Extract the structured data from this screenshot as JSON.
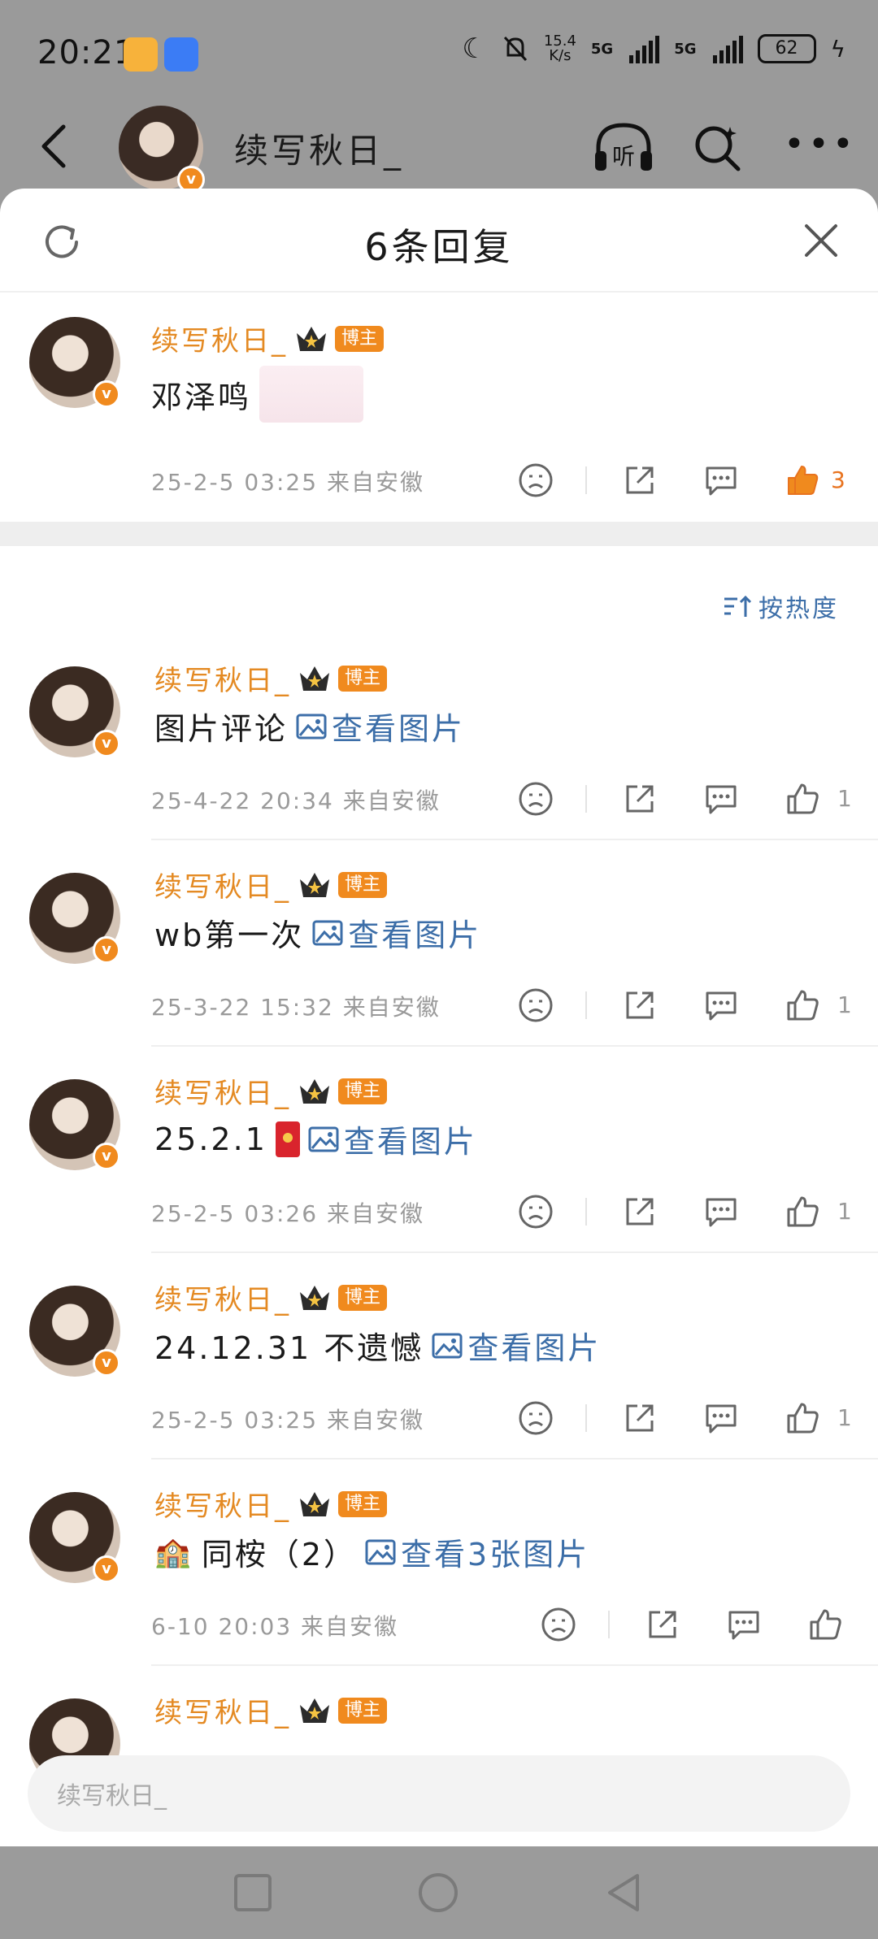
{
  "status_bar": {
    "time": "20:21",
    "net_speed_value": "15.4",
    "net_speed_unit": "K/s",
    "signal_1": "5G",
    "signal_2": "5G",
    "battery": "62"
  },
  "header": {
    "title": "续写秋日_"
  },
  "sheet": {
    "title": "6条回复"
  },
  "top_comment": {
    "username": "续写秋日_",
    "badge": "博主",
    "text": "邓泽鸣",
    "meta": "25-2-5 03:25 来自安徽",
    "likes": "3"
  },
  "sort_label": "按热度",
  "replies": [
    {
      "username": "续写秋日_",
      "badge": "博主",
      "text": "图片评论",
      "link": "查看图片",
      "meta": "25-4-22 20:34 来自安徽",
      "likes": "1"
    },
    {
      "username": "续写秋日_",
      "badge": "博主",
      "text": "wb第一次",
      "link": "查看图片",
      "meta": "25-3-22 15:32 来自安徽",
      "likes": "1"
    },
    {
      "username": "续写秋日_",
      "badge": "博主",
      "text": "25.2.1",
      "link": "查看图片",
      "meta": "25-2-5 03:26 来自安徽",
      "likes": "1"
    },
    {
      "username": "续写秋日_",
      "badge": "博主",
      "text": "24.12.31 不遗憾",
      "link": "查看图片",
      "meta": "25-2-5 03:25 来自安徽",
      "likes": "1"
    },
    {
      "username": "续写秋日_",
      "badge": "博主",
      "text": "同桉（2）",
      "link": "查看3张图片",
      "meta": "6-10 20:03 来自安徽",
      "likes": ""
    },
    {
      "username": "续写秋日_",
      "badge": "博主"
    }
  ],
  "input": {
    "value": "续写秋日_"
  },
  "colors": {
    "accent_orange": "#f08a1e",
    "username_orange": "#e48a23",
    "link_blue": "#3c6ea8"
  }
}
